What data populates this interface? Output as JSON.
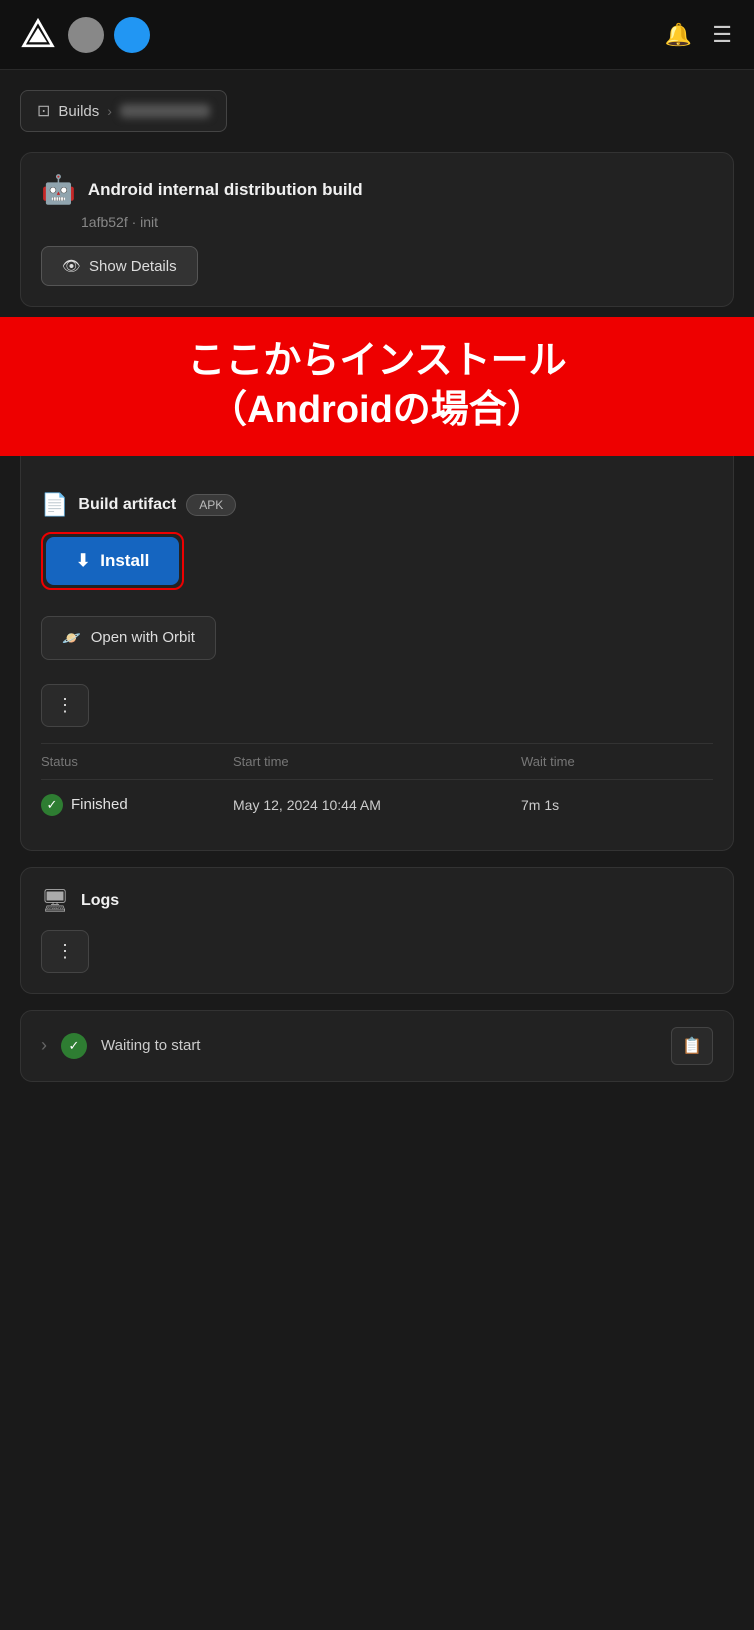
{
  "header": {
    "logo_alt": "Appcircle logo",
    "bell_icon": "🔔",
    "menu_icon": "☰"
  },
  "breadcrumb": {
    "icon": "⊡",
    "builds_label": "Builds",
    "separator": "›"
  },
  "build_card": {
    "android_icon": "🤖",
    "title": "Android internal distribution build",
    "subtitle": "1afb52f · init",
    "show_details_label": "Show Details",
    "eye_icon": "👁"
  },
  "red_banner": {
    "line1": "ここからインストール",
    "line2": "（Androidの場合）"
  },
  "artifact": {
    "icon": "📄",
    "title": "Build artifact",
    "apk_badge": "APK",
    "install_icon": "⬇",
    "install_label": "Install",
    "orbit_icon": "🪐",
    "orbit_label": "Open with Orbit",
    "more_icon": "⋮"
  },
  "status_table": {
    "col_status": "Status",
    "col_start_time": "Start time",
    "col_wait_time": "Wait time",
    "row": {
      "status": "Finished",
      "check": "✓",
      "start_time": "May 12, 2024 10:44 AM",
      "wait_time": "7m 1s"
    }
  },
  "logs": {
    "icon": "🖥",
    "title": "Logs",
    "more_icon": "⋮"
  },
  "waiting": {
    "chevron": "›",
    "check": "✓",
    "text": "Waiting to start",
    "clipboard_icon": "📋"
  }
}
